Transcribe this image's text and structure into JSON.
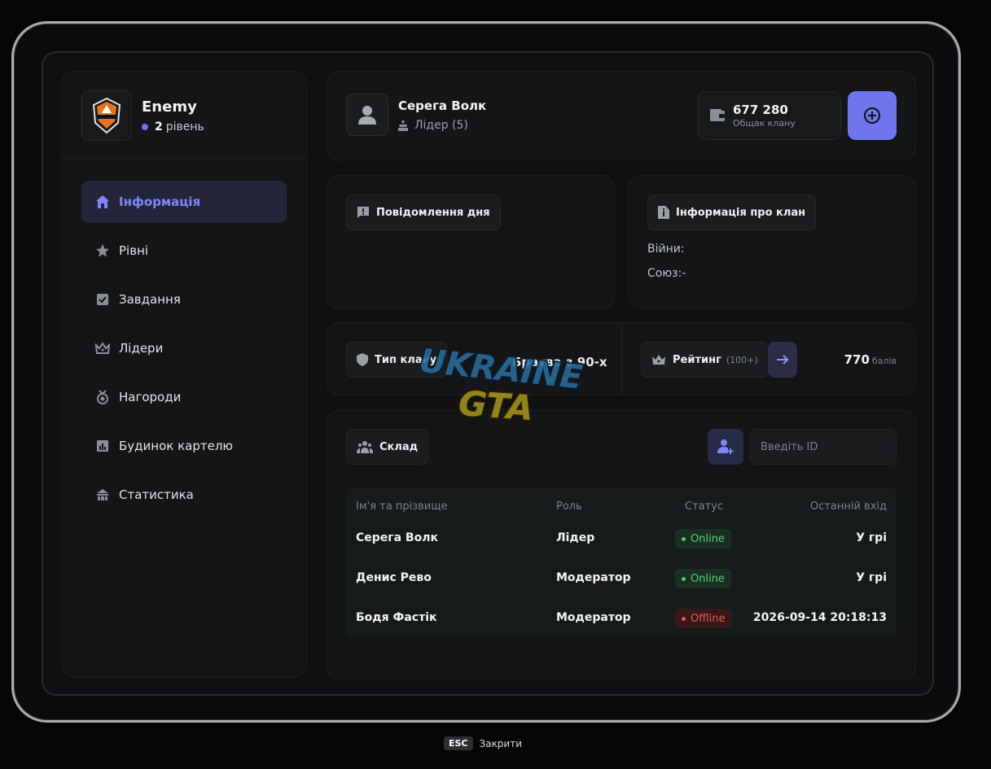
{
  "clan": {
    "name": "Enemy",
    "level_number": "2",
    "level_label": "рівень"
  },
  "nav": [
    {
      "label": "Інформація",
      "icon": "home-icon",
      "active": true
    },
    {
      "label": "Рівні",
      "icon": "star-icon"
    },
    {
      "label": "Завдання",
      "icon": "checkbox-icon"
    },
    {
      "label": "Лідери",
      "icon": "crown-icon"
    },
    {
      "label": "Нагороди",
      "icon": "medal-icon"
    },
    {
      "label": "Будинок картелю",
      "icon": "chart-icon"
    },
    {
      "label": "Статистика",
      "icon": "building-icon"
    }
  ],
  "player": {
    "name": "Серега Волк",
    "role": "Лідер (5)"
  },
  "money": {
    "value": "677 280",
    "label": "Общак клану"
  },
  "motd": {
    "title": "Повідомлення дня"
  },
  "clan_info": {
    "title": "Інформація про клан",
    "wars": "Війни:",
    "union": "Союз:-"
  },
  "clan_type": {
    "label": "Тип клану",
    "value": "Братва з 90-х"
  },
  "rating": {
    "label": "Рейтинг",
    "sub": "(100+)",
    "points": "770",
    "points_unit": "балів"
  },
  "roster": {
    "title": "Склад",
    "id_placeholder": "Введіть ID",
    "headers": [
      "Ім'я та прізвище",
      "Роль",
      "Статус",
      "Останній вхід"
    ],
    "rows": [
      {
        "name": "Серега Волк",
        "role": "Лідер",
        "status": "Online",
        "last": "У грі"
      },
      {
        "name": "Денис Рево",
        "role": "Модератор",
        "status": "Online",
        "last": "У грі"
      },
      {
        "name": "Бодя Фастік",
        "role": "Модератор",
        "status": "Offline",
        "last": "2026-09-14 20:18:13"
      }
    ]
  },
  "watermark": {
    "line1": "UKRAINE",
    "line2": "GTA"
  },
  "footer": {
    "key": "ESC",
    "label": "Закрити"
  },
  "colors": {
    "accent": "#6f76ec",
    "online": "#4ecf77",
    "offline": "#ef5353"
  }
}
